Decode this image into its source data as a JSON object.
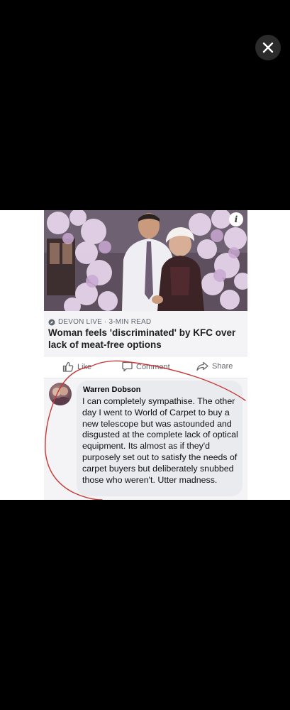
{
  "viewer": {
    "close_icon": "close-icon"
  },
  "post": {
    "photo_icon": "info-icon",
    "info_label": "i",
    "source": "DEVON LIVE · 3-MIN READ",
    "headline": "Woman feels 'discriminated' by KFC over lack of meat-free options",
    "actions": {
      "like": "Like",
      "comment": "Comment",
      "share": "Share"
    }
  },
  "comment": {
    "author": "Warren Dobson",
    "text": "I can completely sympathise. The other day I went to World of Carpet to buy a new telescope but was astounded and disgusted at the complete lack of optical equipment. Its almost as if they'd purposely set out to satisfy the needs of carpet buyers but deliberately snubbed those who weren't. Utter madness."
  },
  "colors": {
    "annotation": "#c83a3a",
    "meta_text": "#606770",
    "bubble_bg": "#e9ebee"
  }
}
